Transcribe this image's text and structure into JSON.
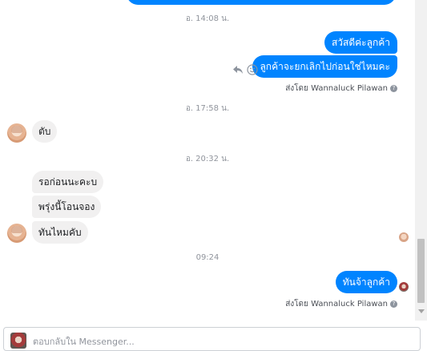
{
  "thread": {
    "timestamps": [
      "อ. 14:08 น.",
      "อ. 17:58 น.",
      "อ. 20:32 น.",
      "09:24"
    ],
    "outgoing_1": [
      "สวัสดีค่ะลูกค้า",
      "ลูกค้าจะยกเลิกไปก่อนใช่ไหมคะ"
    ],
    "incoming_1": [
      "ตับ"
    ],
    "incoming_2": [
      "รอก่อนนะคะบ",
      "พรุ่งนี้โอนจอง",
      "ทันไหมคับ"
    ],
    "outgoing_2": [
      "ทันจ้าลูกค้า"
    ],
    "seen_label": "ส่งโดย",
    "seen_name": "Wannaluck Pilawan",
    "info_glyph": "?"
  },
  "icons": {
    "reply": "reply-icon",
    "emoji": "smiley-icon"
  },
  "composer": {
    "placeholder": "ตอบกลับใน Messenger..."
  },
  "colors": {
    "outgoing_bubble": "#0084ff",
    "incoming_bubble": "#f1f0f0"
  }
}
